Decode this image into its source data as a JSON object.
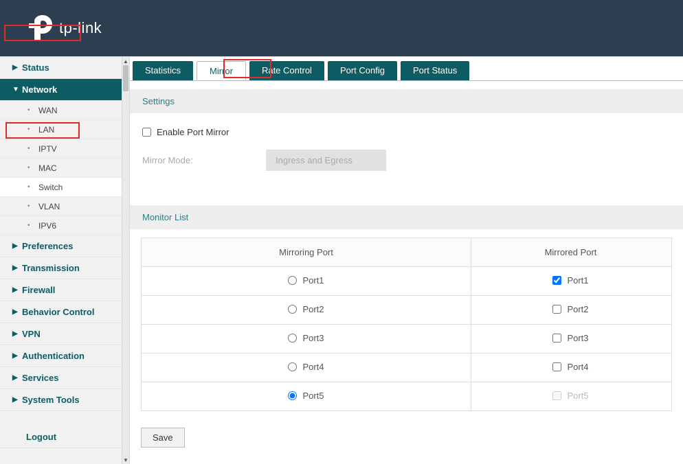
{
  "brand": "tp-link",
  "sidebar": {
    "items": [
      {
        "label": "Status",
        "expanded": false,
        "children": []
      },
      {
        "label": "Network",
        "expanded": true,
        "children": [
          {
            "label": "WAN",
            "active": false
          },
          {
            "label": "LAN",
            "active": false
          },
          {
            "label": "IPTV",
            "active": false
          },
          {
            "label": "MAC",
            "active": false
          },
          {
            "label": "Switch",
            "active": true
          },
          {
            "label": "VLAN",
            "active": false
          },
          {
            "label": "IPV6",
            "active": false
          }
        ]
      },
      {
        "label": "Preferences",
        "expanded": false
      },
      {
        "label": "Transmission",
        "expanded": false
      },
      {
        "label": "Firewall",
        "expanded": false
      },
      {
        "label": "Behavior Control",
        "expanded": false
      },
      {
        "label": "VPN",
        "expanded": false
      },
      {
        "label": "Authentication",
        "expanded": false
      },
      {
        "label": "Services",
        "expanded": false
      },
      {
        "label": "System Tools",
        "expanded": false
      }
    ],
    "logout": "Logout"
  },
  "tabs": [
    {
      "label": "Statistics",
      "active": false
    },
    {
      "label": "Mirror",
      "active": true
    },
    {
      "label": "Rate Control",
      "active": false
    },
    {
      "label": "Port Config",
      "active": false
    },
    {
      "label": "Port Status",
      "active": false
    }
  ],
  "sections": {
    "settings": "Settings",
    "monitor": "Monitor List"
  },
  "settings": {
    "enable_label": "Enable Port Mirror",
    "enable_checked": false,
    "mirror_mode_label": "Mirror Mode:",
    "mirror_mode_value": "Ingress and Egress"
  },
  "table": {
    "headers": {
      "mirroring": "Mirroring Port",
      "mirrored": "Mirrored Port"
    },
    "rows": [
      {
        "port": "Port1",
        "mirroring_selected": false,
        "mirrored_checked": true,
        "mirrored_disabled": false
      },
      {
        "port": "Port2",
        "mirroring_selected": false,
        "mirrored_checked": false,
        "mirrored_disabled": false
      },
      {
        "port": "Port3",
        "mirroring_selected": false,
        "mirrored_checked": false,
        "mirrored_disabled": false
      },
      {
        "port": "Port4",
        "mirroring_selected": false,
        "mirrored_checked": false,
        "mirrored_disabled": false
      },
      {
        "port": "Port5",
        "mirroring_selected": true,
        "mirrored_checked": false,
        "mirrored_disabled": true
      }
    ]
  },
  "buttons": {
    "save": "Save"
  }
}
